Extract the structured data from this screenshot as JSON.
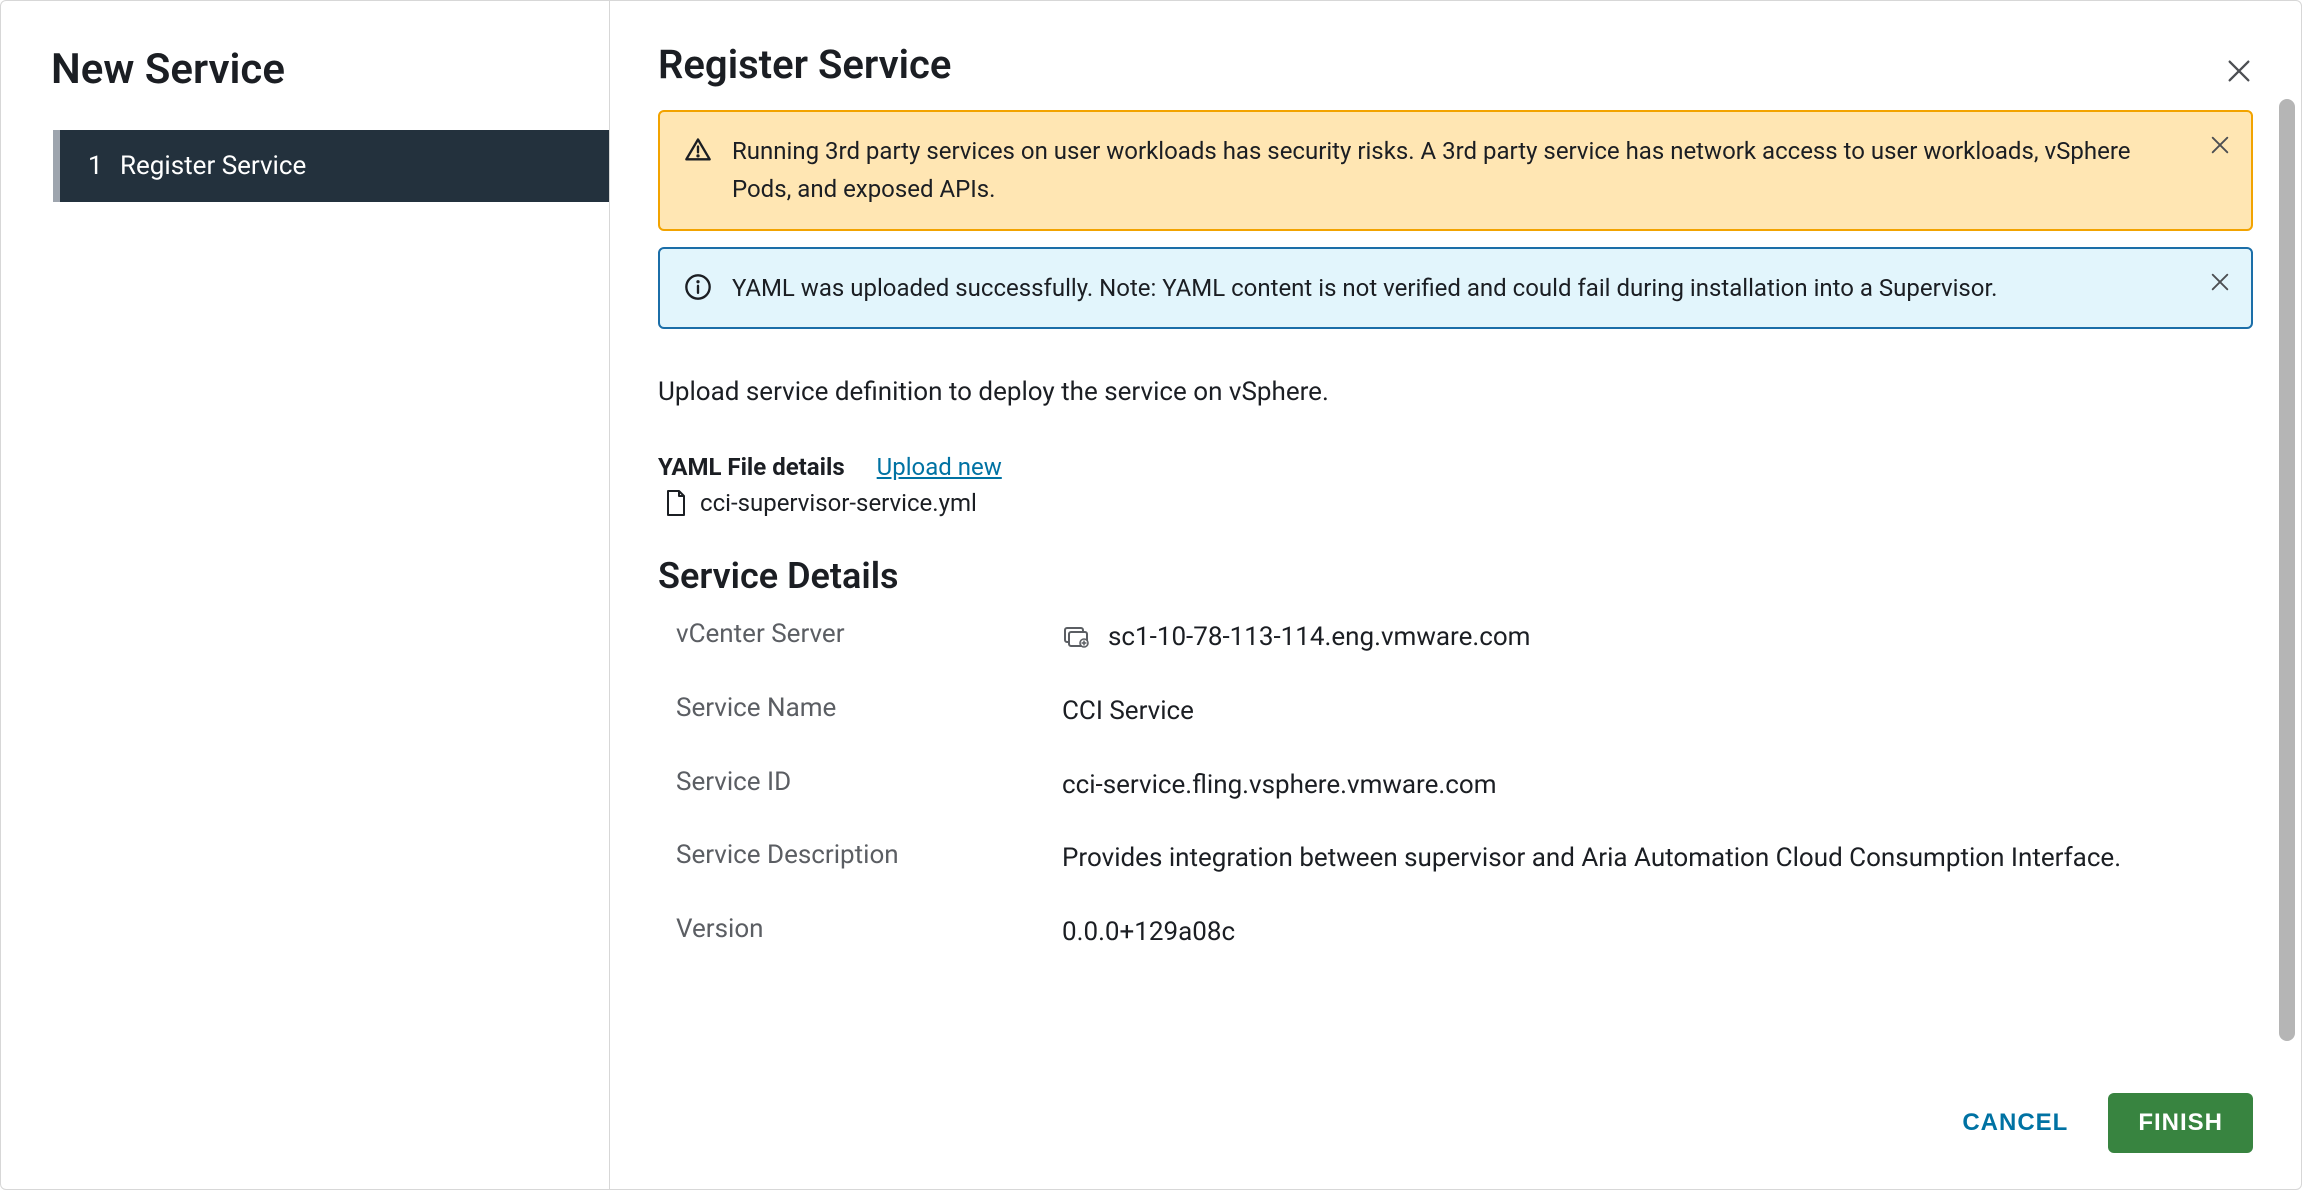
{
  "sidebar": {
    "title": "New Service",
    "steps": [
      {
        "number": "1",
        "label": "Register Service"
      }
    ]
  },
  "header": {
    "title": "Register Service"
  },
  "alerts": {
    "warning_text": "Running 3rd party services on user workloads has security risks. A 3rd party service has network access to user workloads, vSphere Pods, and exposed APIs.",
    "info_text": "YAML was uploaded successfully. Note: YAML content is not verified and could fail during installation into a Supervisor."
  },
  "instruction": "Upload service definition to deploy the service on vSphere.",
  "yaml": {
    "label": "YAML File details",
    "upload_link": "Upload new",
    "filename": "cci-supervisor-service.yml"
  },
  "service_details": {
    "title": "Service Details",
    "labels": {
      "vcenter": "vCenter Server",
      "name": "Service Name",
      "id": "Service ID",
      "description": "Service Description",
      "version": "Version"
    },
    "values": {
      "vcenter": "sc1-10-78-113-114.eng.vmware.com",
      "name": "CCI Service",
      "id": "cci-service.fling.vsphere.vmware.com",
      "description": "Provides integration between supervisor and Aria Automation Cloud Consumption Interface.",
      "version": "0.0.0+129a08c"
    }
  },
  "footer": {
    "cancel": "CANCEL",
    "finish": "FINISH"
  }
}
